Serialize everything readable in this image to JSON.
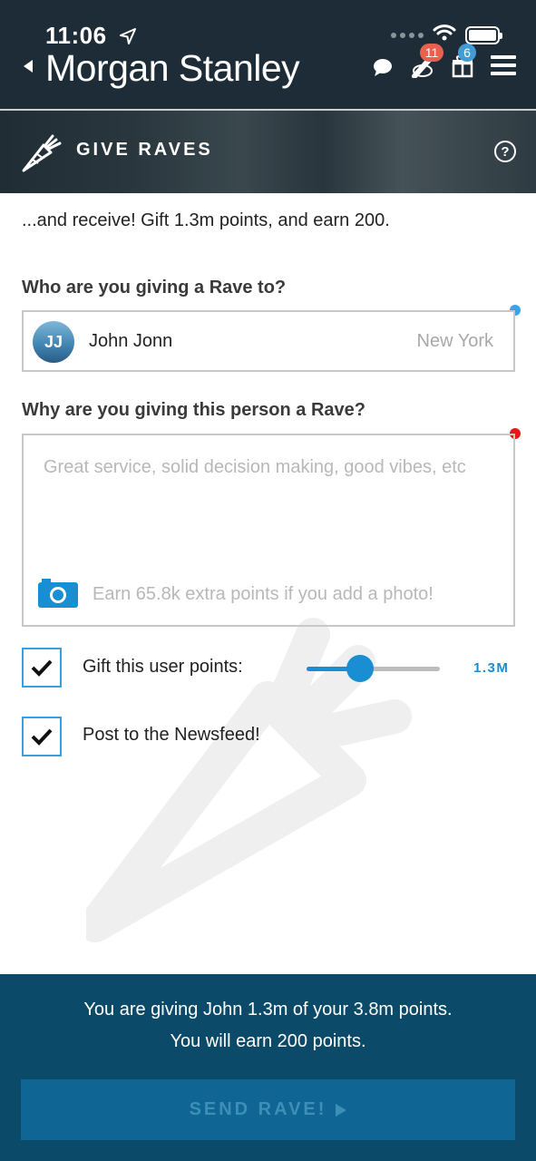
{
  "status_bar": {
    "time": "11:06"
  },
  "header": {
    "brand": "Morgan Stanley",
    "notifications_badge": "11",
    "gifts_badge": "6"
  },
  "banner": {
    "title": "GIVE RAVES",
    "help_label": "?"
  },
  "intro": "...and receive! Gift 1.3m points, and earn 200.",
  "recipient_section": {
    "label": "Who are you giving a Rave to?",
    "avatar_initials": "JJ",
    "name": "John Jonn",
    "city": "New York"
  },
  "reason_section": {
    "label": "Why are you giving this person a Rave?",
    "placeholder": "Great service, solid decision making, good vibes, etc",
    "photo_hint": "Earn 65.8k extra points if you add a photo!"
  },
  "options": {
    "gift_points": {
      "label": "Gift this user points:",
      "checked": true,
      "slider_fraction": 0.4,
      "value": "1.3M"
    },
    "newsfeed": {
      "label": "Post to the Newsfeed!",
      "checked": true
    }
  },
  "footer": {
    "line1": "You are giving John 1.3m of your 3.8m points.",
    "line2": "You will earn 200 points.",
    "send_label": "SEND RAVE!"
  },
  "colors": {
    "header_bg": "#1d2c36",
    "accent": "#1a8ed2",
    "footer_bg": "#0b4a69",
    "badge_red": "#e8604f",
    "badge_blue": "#3f9cd6"
  },
  "icons": [
    "location-arrow-icon",
    "wifi-icon",
    "battery-icon",
    "back-chevron-icon",
    "chat-icon",
    "raves-icon",
    "gift-icon",
    "menu-icon",
    "carrot-logo-icon",
    "help-icon",
    "camera-icon",
    "checkmark-icon",
    "play-arrow-icon"
  ]
}
